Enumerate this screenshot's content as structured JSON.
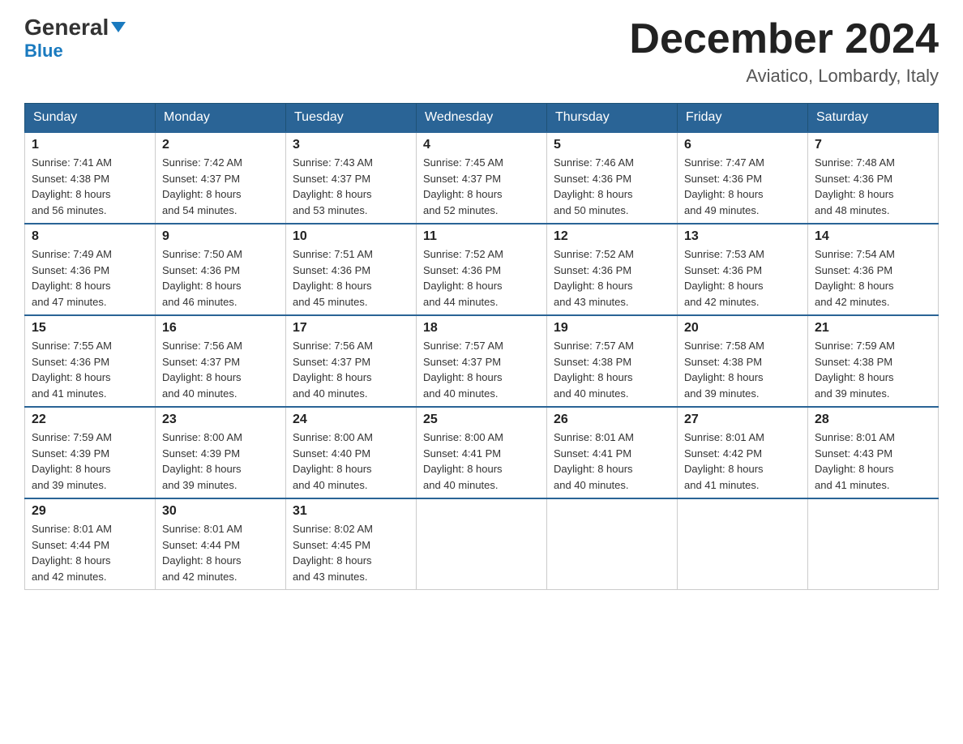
{
  "header": {
    "logo_general": "General",
    "logo_blue": "Blue",
    "month_title": "December 2024",
    "location": "Aviatico, Lombardy, Italy"
  },
  "days_of_week": [
    "Sunday",
    "Monday",
    "Tuesday",
    "Wednesday",
    "Thursday",
    "Friday",
    "Saturday"
  ],
  "weeks": [
    [
      {
        "day": "1",
        "sunrise": "7:41 AM",
        "sunset": "4:38 PM",
        "daylight": "8 hours and 56 minutes."
      },
      {
        "day": "2",
        "sunrise": "7:42 AM",
        "sunset": "4:37 PM",
        "daylight": "8 hours and 54 minutes."
      },
      {
        "day": "3",
        "sunrise": "7:43 AM",
        "sunset": "4:37 PM",
        "daylight": "8 hours and 53 minutes."
      },
      {
        "day": "4",
        "sunrise": "7:45 AM",
        "sunset": "4:37 PM",
        "daylight": "8 hours and 52 minutes."
      },
      {
        "day": "5",
        "sunrise": "7:46 AM",
        "sunset": "4:36 PM",
        "daylight": "8 hours and 50 minutes."
      },
      {
        "day": "6",
        "sunrise": "7:47 AM",
        "sunset": "4:36 PM",
        "daylight": "8 hours and 49 minutes."
      },
      {
        "day": "7",
        "sunrise": "7:48 AM",
        "sunset": "4:36 PM",
        "daylight": "8 hours and 48 minutes."
      }
    ],
    [
      {
        "day": "8",
        "sunrise": "7:49 AM",
        "sunset": "4:36 PM",
        "daylight": "8 hours and 47 minutes."
      },
      {
        "day": "9",
        "sunrise": "7:50 AM",
        "sunset": "4:36 PM",
        "daylight": "8 hours and 46 minutes."
      },
      {
        "day": "10",
        "sunrise": "7:51 AM",
        "sunset": "4:36 PM",
        "daylight": "8 hours and 45 minutes."
      },
      {
        "day": "11",
        "sunrise": "7:52 AM",
        "sunset": "4:36 PM",
        "daylight": "8 hours and 44 minutes."
      },
      {
        "day": "12",
        "sunrise": "7:52 AM",
        "sunset": "4:36 PM",
        "daylight": "8 hours and 43 minutes."
      },
      {
        "day": "13",
        "sunrise": "7:53 AM",
        "sunset": "4:36 PM",
        "daylight": "8 hours and 42 minutes."
      },
      {
        "day": "14",
        "sunrise": "7:54 AM",
        "sunset": "4:36 PM",
        "daylight": "8 hours and 42 minutes."
      }
    ],
    [
      {
        "day": "15",
        "sunrise": "7:55 AM",
        "sunset": "4:36 PM",
        "daylight": "8 hours and 41 minutes."
      },
      {
        "day": "16",
        "sunrise": "7:56 AM",
        "sunset": "4:37 PM",
        "daylight": "8 hours and 40 minutes."
      },
      {
        "day": "17",
        "sunrise": "7:56 AM",
        "sunset": "4:37 PM",
        "daylight": "8 hours and 40 minutes."
      },
      {
        "day": "18",
        "sunrise": "7:57 AM",
        "sunset": "4:37 PM",
        "daylight": "8 hours and 40 minutes."
      },
      {
        "day": "19",
        "sunrise": "7:57 AM",
        "sunset": "4:38 PM",
        "daylight": "8 hours and 40 minutes."
      },
      {
        "day": "20",
        "sunrise": "7:58 AM",
        "sunset": "4:38 PM",
        "daylight": "8 hours and 39 minutes."
      },
      {
        "day": "21",
        "sunrise": "7:59 AM",
        "sunset": "4:38 PM",
        "daylight": "8 hours and 39 minutes."
      }
    ],
    [
      {
        "day": "22",
        "sunrise": "7:59 AM",
        "sunset": "4:39 PM",
        "daylight": "8 hours and 39 minutes."
      },
      {
        "day": "23",
        "sunrise": "8:00 AM",
        "sunset": "4:39 PM",
        "daylight": "8 hours and 39 minutes."
      },
      {
        "day": "24",
        "sunrise": "8:00 AM",
        "sunset": "4:40 PM",
        "daylight": "8 hours and 40 minutes."
      },
      {
        "day": "25",
        "sunrise": "8:00 AM",
        "sunset": "4:41 PM",
        "daylight": "8 hours and 40 minutes."
      },
      {
        "day": "26",
        "sunrise": "8:01 AM",
        "sunset": "4:41 PM",
        "daylight": "8 hours and 40 minutes."
      },
      {
        "day": "27",
        "sunrise": "8:01 AM",
        "sunset": "4:42 PM",
        "daylight": "8 hours and 41 minutes."
      },
      {
        "day": "28",
        "sunrise": "8:01 AM",
        "sunset": "4:43 PM",
        "daylight": "8 hours and 41 minutes."
      }
    ],
    [
      {
        "day": "29",
        "sunrise": "8:01 AM",
        "sunset": "4:44 PM",
        "daylight": "8 hours and 42 minutes."
      },
      {
        "day": "30",
        "sunrise": "8:01 AM",
        "sunset": "4:44 PM",
        "daylight": "8 hours and 42 minutes."
      },
      {
        "day": "31",
        "sunrise": "8:02 AM",
        "sunset": "4:45 PM",
        "daylight": "8 hours and 43 minutes."
      },
      null,
      null,
      null,
      null
    ]
  ],
  "labels": {
    "sunrise": "Sunrise:",
    "sunset": "Sunset:",
    "daylight": "Daylight:"
  }
}
